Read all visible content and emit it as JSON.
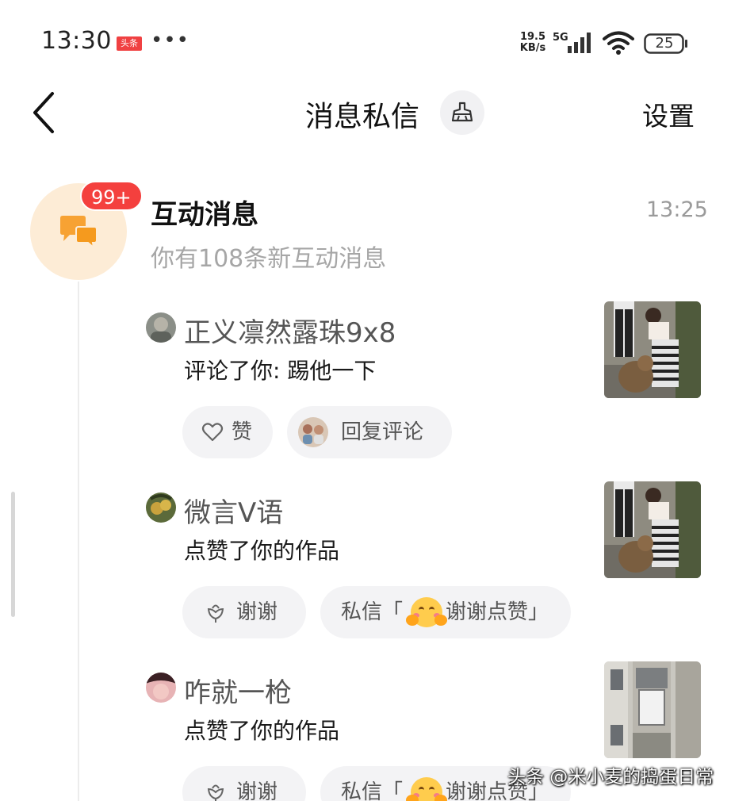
{
  "status_bar": {
    "time": "13:30",
    "app_badge": "头条",
    "dots": "•••",
    "net_speed_value": "19.5",
    "net_speed_unit": "KB/s",
    "net_type": "5G",
    "battery": "25"
  },
  "nav": {
    "title": "消息私信",
    "settings_label": "设置"
  },
  "interaction": {
    "badge": "99+",
    "title": "互动消息",
    "time": "13:25",
    "subtitle": "你有108条新互动消息"
  },
  "messages": [
    {
      "name": "正义凛然露珠9x8",
      "text": "评论了你:  踢他一下",
      "actions": {
        "like_label": "赞",
        "reply_label": "回复评论"
      }
    },
    {
      "name": "微言V语",
      "text": "点赞了你的作品",
      "actions": {
        "thanks_label": "谢谢",
        "dm_prefix": "私信「",
        "dm_text": "谢谢点赞」"
      }
    },
    {
      "name": "咋就一枪",
      "text": "点赞了你的作品",
      "actions": {
        "thanks_label": "谢谢",
        "dm_prefix": "私信「",
        "dm_text": "谢谢点赞」"
      }
    }
  ],
  "watermark": "头条 @米小麦的捣蛋日常",
  "colors": {
    "badge_red": "#f4403e",
    "interaction_bg": "#fdecd6",
    "interaction_icon": "#f7a233",
    "chip_bg": "#f3f3f5",
    "muted_text": "#a6a6a6"
  },
  "icons": [
    "back-icon",
    "broom-clean-icon",
    "chat-bubbles-icon",
    "heart-icon",
    "flower-thanks-icon",
    "hug-emoji-icon",
    "signal-icon",
    "wifi-icon",
    "battery-icon"
  ]
}
